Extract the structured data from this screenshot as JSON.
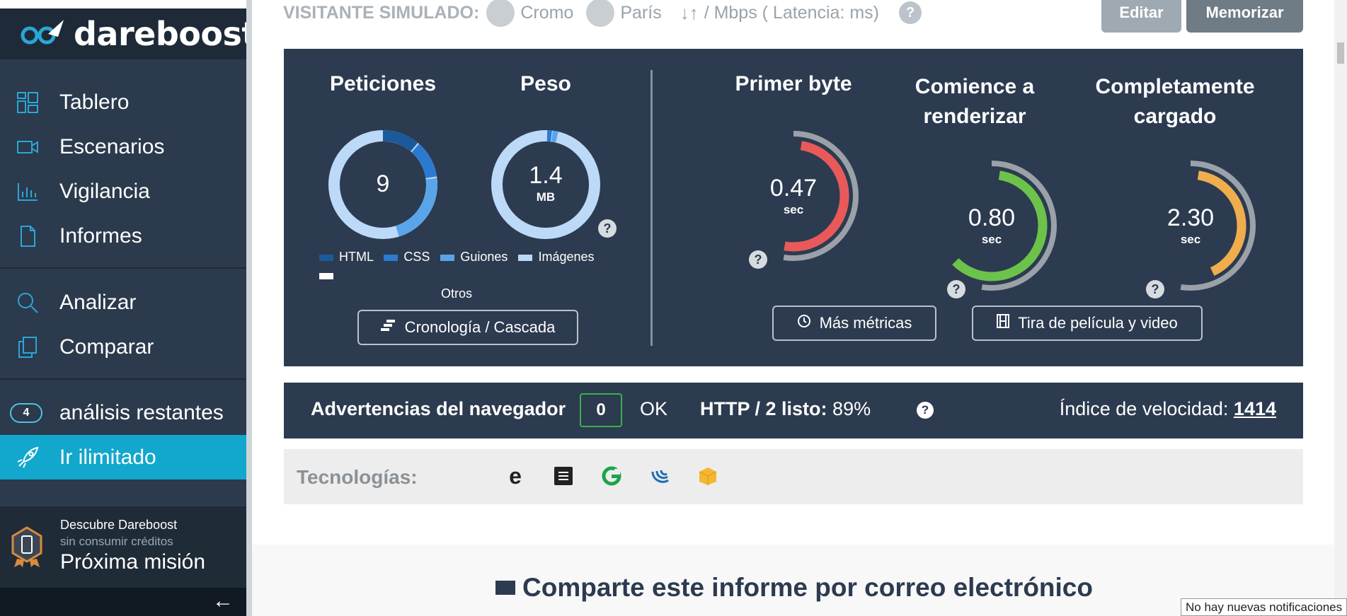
{
  "brand": {
    "name": "dareboost"
  },
  "sidebar": {
    "items": [
      {
        "label": "Tablero",
        "icon": "dashboard-icon"
      },
      {
        "label": "Escenarios",
        "icon": "video-camera-icon"
      },
      {
        "label": "Vigilancia",
        "icon": "bar-chart-icon"
      },
      {
        "label": "Informes",
        "icon": "document-icon"
      },
      {
        "label": "Analizar",
        "icon": "search-icon"
      },
      {
        "label": "Comparar",
        "icon": "copy-icon"
      }
    ],
    "remaining": {
      "count": "4",
      "label": "análisis restantes"
    },
    "unlimited": {
      "label": "Ir ilimitado",
      "icon": "rocket-icon"
    },
    "mission": {
      "line1": "Descubre Dareboost",
      "line2": "sin consumir créditos",
      "line3": "Próxima misión"
    },
    "collapse_arrow": "←"
  },
  "header": {
    "visitor_label": "VISITANTE SIMULADO:",
    "browser": "Cromo",
    "location": "París",
    "connection": "/ Mbps ( Latencia: ms)",
    "help": "?",
    "edit_button": "Editar",
    "memorize_button": "Memorizar"
  },
  "metrics": {
    "requests": {
      "title": "Peticiones",
      "value": "9"
    },
    "weight": {
      "title": "Peso",
      "value": "1.4",
      "unit": "MB"
    },
    "legend": [
      {
        "label": "HTML",
        "color": "#1a5a9a"
      },
      {
        "label": "CSS",
        "color": "#2a7ad2"
      },
      {
        "label": "Guiones",
        "color": "#5aa5ea"
      },
      {
        "label": "Imágenes",
        "color": "#bcd9f8"
      },
      {
        "label": "Otros",
        "color": "#ffffff"
      }
    ],
    "timeline_button": "Cronología / Cascada",
    "first_byte": {
      "title": "Primer byte",
      "value": "0.47",
      "unit": "sec",
      "color": "#e85a5a",
      "fraction": 0.72
    },
    "start_render": {
      "title_line1": "Comience a",
      "title_line2": "renderizar",
      "value": "0.80",
      "unit": "sec",
      "color": "#6cc24a",
      "fraction": 0.86
    },
    "fully_loaded": {
      "title_line1": "Completamente",
      "title_line2": "cargado",
      "value": "2.30",
      "unit": "sec",
      "color": "#f0ad4e",
      "fraction": 0.58
    },
    "more_metrics_button": "Más métricas",
    "filmstrip_button": "Tira de película y video",
    "help": "?"
  },
  "warnings": {
    "label": "Advertencias del navegador",
    "count": "0",
    "status": "OK",
    "http2_label": "HTTP / 2 listo:",
    "http2_value": "89%",
    "help": "?",
    "speed_label": "Índice de velocidad:",
    "speed_value": "1414"
  },
  "technologies": {
    "label": "Tecnologías:",
    "icons": [
      "e-icon",
      "grid-icon",
      "g-logo-icon",
      "jquery-icon",
      "box-icon"
    ]
  },
  "share": {
    "title": "Comparte este informe por correo electrónico"
  },
  "notification": "No hay nuevas notificaciones"
}
